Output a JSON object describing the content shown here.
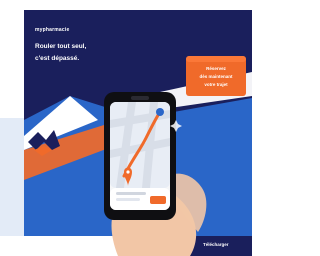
{
  "image": {
    "brand": "mypharmacie",
    "headline_line1": "Rouler tout seul,",
    "headline_line2": "c'est dépassé.",
    "promo_line1": "Réservez",
    "promo_line2": "dès maintenant",
    "promo_line3": "votre trajet",
    "footer_label": "Télécharger",
    "colors": {
      "navy": "#1a1f5c",
      "blue": "#2a66c8",
      "orange": "#f06a2a",
      "sky": "#e3ebf7",
      "white": "#ffffff"
    }
  }
}
